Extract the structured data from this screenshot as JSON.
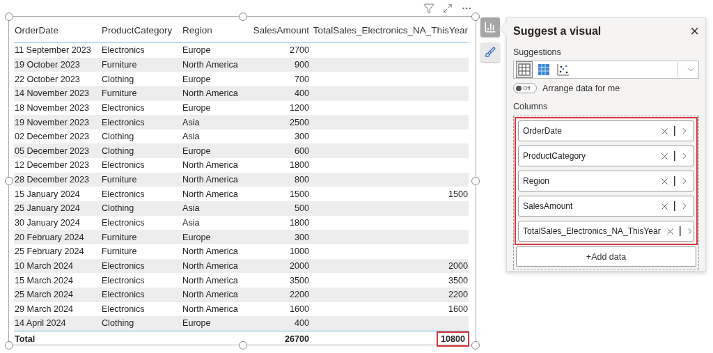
{
  "table": {
    "columns": [
      "OrderDate",
      "ProductCategory",
      "Region",
      "SalesAmount",
      "TotalSales_Electronics_NA_ThisYear"
    ],
    "rows": [
      [
        "11 September 2023",
        "Electronics",
        "Europe",
        "2700",
        null
      ],
      [
        "19 October 2023",
        "Furniture",
        "North America",
        "900",
        null
      ],
      [
        "22 October 2023",
        "Clothing",
        "Europe",
        "700",
        null
      ],
      [
        "14 November 2023",
        "Furniture",
        "North America",
        "400",
        null
      ],
      [
        "18 November 2023",
        "Electronics",
        "Europe",
        "1200",
        null
      ],
      [
        "19 November 2023",
        "Electronics",
        "Asia",
        "2500",
        null
      ],
      [
        "02 December 2023",
        "Clothing",
        "Asia",
        "300",
        null
      ],
      [
        "05 December 2023",
        "Clothing",
        "Europe",
        "600",
        null
      ],
      [
        "12 December 2023",
        "Electronics",
        "North America",
        "1800",
        null
      ],
      [
        "28 December 2023",
        "Furniture",
        "North America",
        "800",
        null
      ],
      [
        "15 January 2024",
        "Electronics",
        "North America",
        "1500",
        "1500"
      ],
      [
        "25 January 2024",
        "Clothing",
        "Asia",
        "500",
        null
      ],
      [
        "30 January 2024",
        "Electronics",
        "Asia",
        "1800",
        null
      ],
      [
        "20 February 2024",
        "Furniture",
        "Europe",
        "300",
        null
      ],
      [
        "25 February 2024",
        "Furniture",
        "North America",
        "1000",
        null
      ],
      [
        "10 March 2024",
        "Electronics",
        "North America",
        "2000",
        "2000"
      ],
      [
        "15 March 2024",
        "Electronics",
        "North America",
        "3500",
        "3500"
      ],
      [
        "25 March 2024",
        "Electronics",
        "North America",
        "2200",
        "2200"
      ],
      [
        "29 March 2024",
        "Electronics",
        "North America",
        "1600",
        "1600"
      ],
      [
        "14 April 2024",
        "Clothing",
        "Europe",
        "400",
        null
      ]
    ],
    "total": {
      "label": "Total",
      "sales": "26700",
      "measure": "10800",
      "measure_highlighted": true
    }
  },
  "panel": {
    "title": "Suggest a visual",
    "close": "×",
    "suggestions_label": "Suggestions",
    "suggestions": [
      {
        "kind": "table",
        "selected": true
      },
      {
        "kind": "matrix",
        "selected": false
      },
      {
        "kind": "scatter",
        "selected": false
      }
    ],
    "toggle": {
      "on": false,
      "state_text": "Off",
      "label": "Arrange data for me"
    },
    "columns_label": "Columns",
    "columns_highlighted": true,
    "columns": [
      "OrderDate",
      "ProductCategory",
      "Region",
      "SalesAmount",
      "TotalSales_Electronics_NA_ThisYear"
    ],
    "add_button": "+Add data"
  }
}
